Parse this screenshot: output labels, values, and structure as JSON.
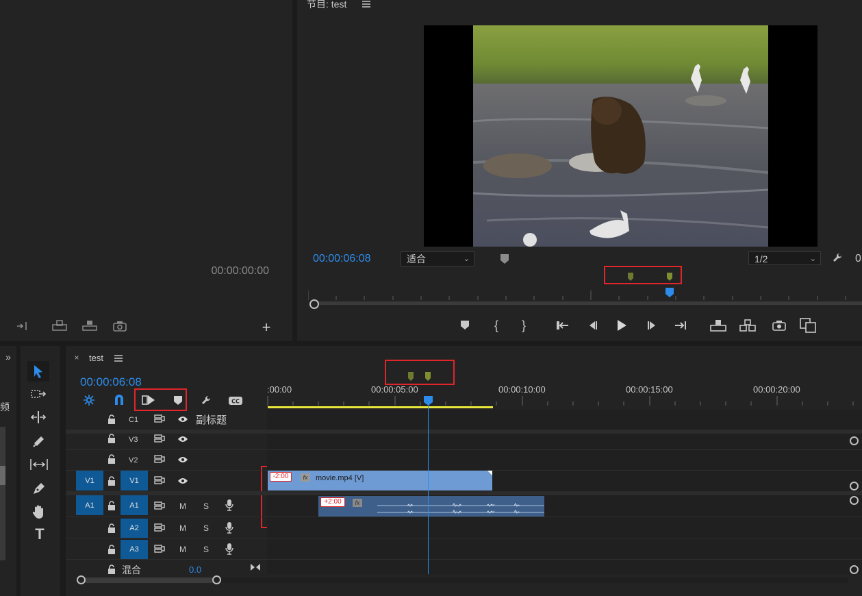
{
  "source_monitor": {
    "timecode": "00:00:00:00"
  },
  "program_monitor": {
    "title": "节目: test",
    "menu_icon": "hamburger-menu-icon",
    "timecode": "00:00:06:08",
    "zoom_select": "适合",
    "resolution_select": "1/2",
    "right_label": "0",
    "playhead_fraction": 0.66
  },
  "sequence": {
    "tab_title": "test",
    "timecode": "00:00:06:08",
    "ruler_labels": [
      ":00:00",
      "00:00:05:00",
      "00:00:10:00",
      "00:00:15:00",
      "00:00:20:00"
    ],
    "tracks": {
      "c1": {
        "label": "C1",
        "name": "副标题"
      },
      "v3": {
        "label": "V3"
      },
      "v2": {
        "label": "V2"
      },
      "v1": {
        "label": "V1",
        "source": "V1"
      },
      "a1": {
        "label": "A1",
        "source": "A1",
        "m": "M",
        "s": "S"
      },
      "a2": {
        "label": "A2",
        "m": "M",
        "s": "S"
      },
      "a3": {
        "label": "A3",
        "m": "M",
        "s": "S"
      }
    },
    "mix": {
      "label": "混合",
      "value": "0.0"
    },
    "video_clip": {
      "name": "movie.mp4 [V]",
      "offset": "-2:00",
      "fx": "fx"
    },
    "audio_clip": {
      "offset": "+2:00",
      "fx": "fx"
    }
  },
  "left_panel_fragment": {
    "text": "频"
  },
  "colors": {
    "accent_blue": "#2d8ceb",
    "video_clip": "#6f9bd4",
    "audio_clip": "#3e5f8a",
    "highlight_red": "#e0252b",
    "work_area": "#e8e83a",
    "marker": "#7a8a32"
  }
}
